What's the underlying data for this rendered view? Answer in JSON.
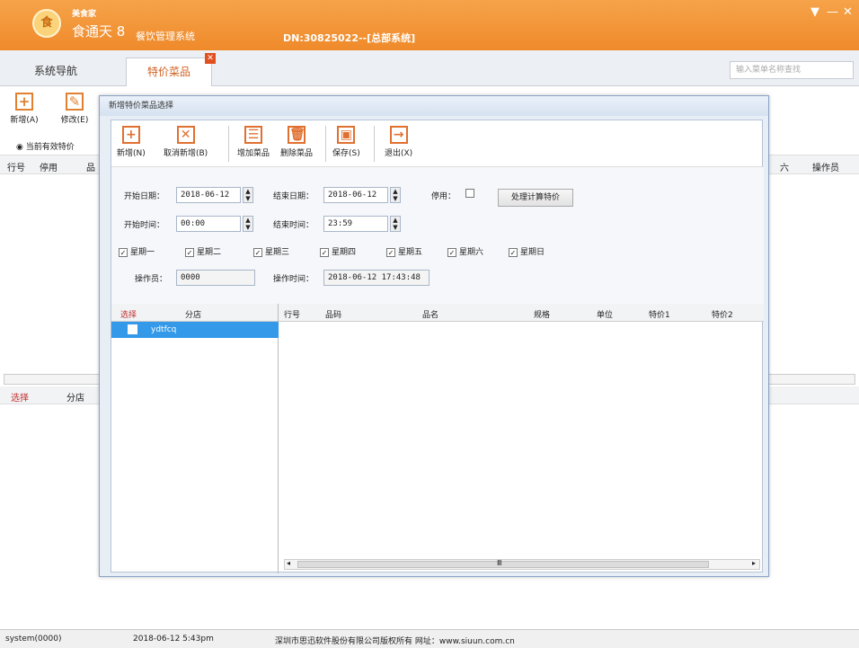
{
  "app": {
    "brand_small": "美食家",
    "brand_big": "食通天 8",
    "brand_sub": "餐饮管理系统",
    "dn": "DN:30825022--[总部系统]",
    "logo": "食",
    "win_controls": [
      "▼",
      "—",
      "✕"
    ]
  },
  "tabs": [
    {
      "label": "系统导航"
    },
    {
      "label": "特价菜品"
    }
  ],
  "tab_close": "✕",
  "search": {
    "placeholder": "输入菜单名称查找"
  },
  "bg_toolbar": {
    "buttons": [
      {
        "label": "新增(A)",
        "icon": "+"
      },
      {
        "label": "修改(E)",
        "icon": "✎"
      }
    ]
  },
  "bg_filter": "◉ 当前有效特价",
  "bg_columns": [
    "行号",
    "停用",
    "品",
    "六",
    "操作员"
  ],
  "bg_columns2": [
    "选择",
    "分店"
  ],
  "dialog": {
    "title": "新增特价菜品选择",
    "toolbar": [
      {
        "label": "新增(N)",
        "icon": "+"
      },
      {
        "label": "取消新增(B)",
        "icon": "✕"
      },
      {
        "label": "增加菜品",
        "icon": "☰"
      },
      {
        "label": "删除菜品",
        "icon": "🗑"
      },
      {
        "label": "保存(S)",
        "icon": "▣"
      },
      {
        "label": "退出(X)",
        "icon": "→"
      }
    ],
    "form": {
      "start_date_label": "开始日期：",
      "start_date": "2018-06-12",
      "end_date_label": "结束日期：",
      "end_date": "2018-06-12",
      "disabled_label": "停用：",
      "calc_button": "处理计算特价",
      "start_time_label": "开始时间：",
      "start_time": "00:00",
      "end_time_label": "结束时间：",
      "end_time": "23:59",
      "operator_label": "操作员：",
      "operator": "0000",
      "op_time_label": "操作时间：",
      "op_time": "2018-06-12 17:43:48"
    },
    "weekdays": [
      {
        "label": "星期一",
        "checked": true
      },
      {
        "label": "星期二",
        "checked": true
      },
      {
        "label": "星期三",
        "checked": true
      },
      {
        "label": "星期四",
        "checked": true
      },
      {
        "label": "星期五",
        "checked": true
      },
      {
        "label": "星期六",
        "checked": true
      },
      {
        "label": "星期日",
        "checked": true
      }
    ],
    "check_mark": "✓",
    "left_grid": {
      "columns": [
        "选择",
        "分店"
      ],
      "rows": [
        {
          "store": "ydtfcq"
        }
      ]
    },
    "right_grid": {
      "columns": [
        "行号",
        "品码",
        "品名",
        "规格",
        "单位",
        "特价1",
        "特价2"
      ],
      "scroll_left": "◂",
      "scroll_mid": "Ⅲ",
      "scroll_right": "▸"
    }
  },
  "status": {
    "user": "system(0000)",
    "datetime": "2018-06-12 5:43pm",
    "copyright": "深圳市思迅软件股份有限公司版权所有 网址：www.siuun.com.cn"
  }
}
